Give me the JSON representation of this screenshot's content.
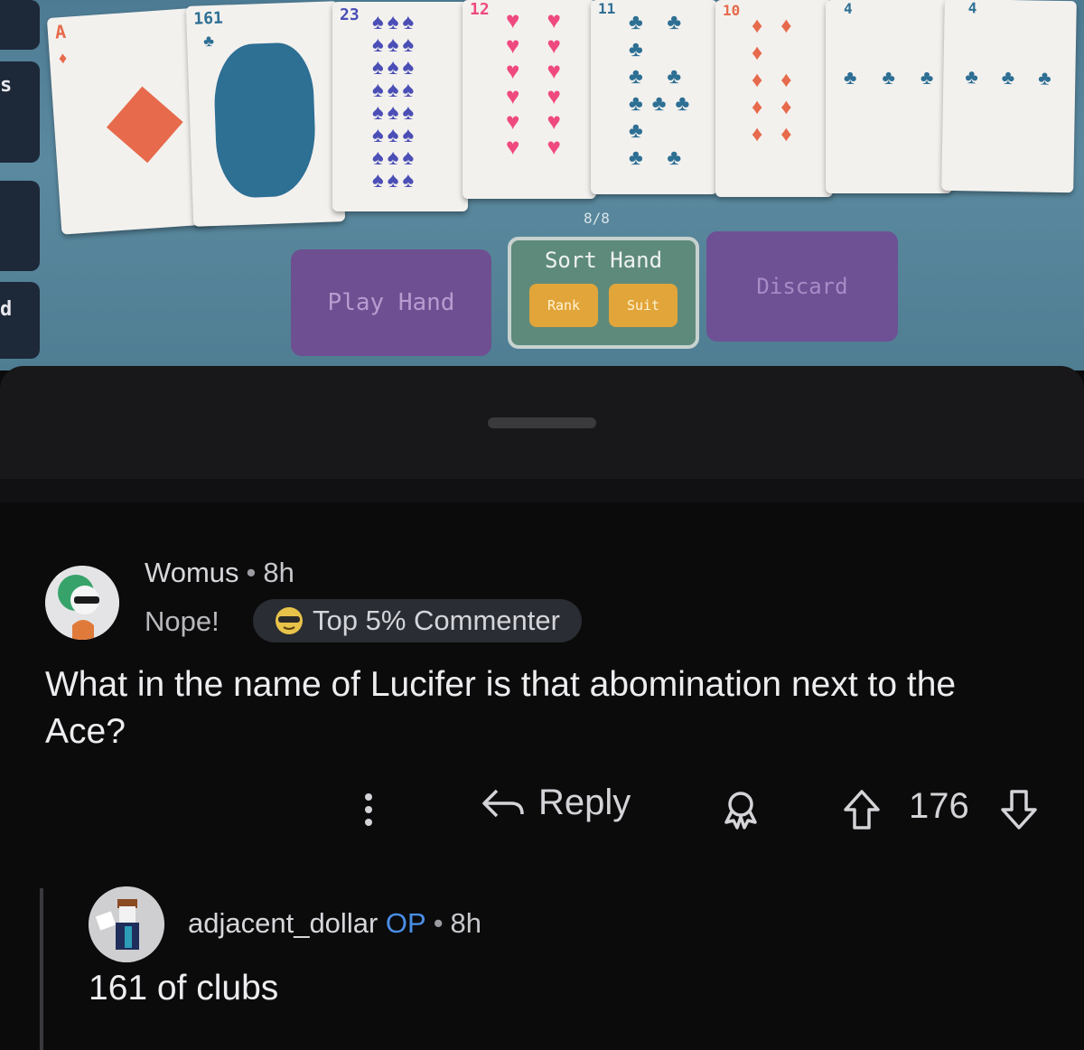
{
  "game": {
    "side_letters": [
      "s",
      "d"
    ],
    "cards": [
      {
        "rank": "A",
        "suit": "diamonds",
        "symbol": "♦"
      },
      {
        "rank": "161",
        "suit": "clubs",
        "symbol": "♣"
      },
      {
        "rank": "23",
        "suit": "spades",
        "symbol": "♠"
      },
      {
        "rank": "12",
        "suit": "hearts",
        "symbol": "♥"
      },
      {
        "rank": "11",
        "suit": "clubs",
        "symbol": "♣"
      },
      {
        "rank": "10",
        "suit": "diamonds",
        "symbol": "♦"
      },
      {
        "rank": "4",
        "suit": "clubs",
        "symbol": "♣"
      },
      {
        "rank": "4",
        "suit": "clubs",
        "symbol": "♣"
      }
    ],
    "hand_count": "8/8",
    "play_hand_label": "Play Hand",
    "sort_hand_label": "Sort Hand",
    "rank_label": "Rank",
    "suit_label": "Suit",
    "discard_label": "Discard"
  },
  "comment": {
    "username": "Womus",
    "age": "8h",
    "flair": "Nope!",
    "badge": "Top 5% Commenter",
    "body": "What in the name of Lucifer is that abomination next to the Ace?",
    "reply_label": "Reply",
    "vote_count": "176"
  },
  "reply": {
    "username": "adjacent_dollar",
    "op_label": "OP",
    "age": "8h",
    "body": "161 of clubs"
  },
  "colors": {
    "op_blue": "#4a8fe7",
    "background": "#0b0b0c",
    "game_felt": "#5b8aa0"
  },
  "icons": [
    "more-vertical-icon",
    "reply-arrow-icon",
    "award-icon",
    "upvote-arrow-icon",
    "downvote-arrow-icon",
    "sunglasses-emoji-icon"
  ]
}
